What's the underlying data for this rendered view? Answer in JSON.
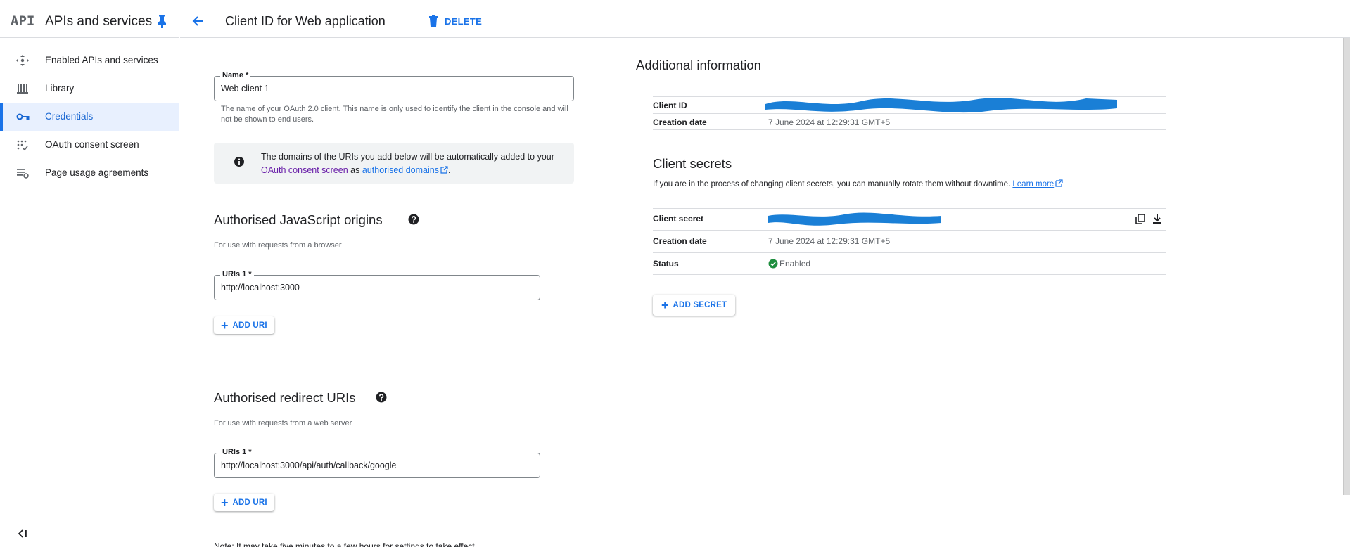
{
  "sidebar": {
    "logo": "API",
    "title": "APIs and services",
    "items": [
      {
        "label": "Enabled APIs and services",
        "icon": "enabled-apis-icon",
        "active": false
      },
      {
        "label": "Library",
        "icon": "library-icon",
        "active": false
      },
      {
        "label": "Credentials",
        "icon": "key-icon",
        "active": true
      },
      {
        "label": "OAuth consent screen",
        "icon": "consent-icon",
        "active": false
      },
      {
        "label": "Page usage agreements",
        "icon": "agreements-icon",
        "active": false
      }
    ]
  },
  "header": {
    "title": "Client ID for Web application",
    "delete_label": "DELETE"
  },
  "form": {
    "name_label": "Name *",
    "name_value": "Web client 1",
    "name_hint": "The name of your OAuth 2.0 client. This name is only used to identify the client in the console and will not be shown to end users.",
    "info_prefix": "The domains of the URIs you add below will be automatically added to your",
    "info_link1": "OAuth consent screen",
    "info_as": "as",
    "info_link2": "authorised domains",
    "info_end": ".",
    "js_origins_title": "Authorised JavaScript origins",
    "js_origins_sub": "For use with requests from a browser",
    "js_uri_label": "URIs 1 *",
    "js_uri_value": "http://localhost:3000",
    "add_uri_label": "ADD URI",
    "redirect_title": "Authorised redirect URIs",
    "redirect_sub": "For use with requests from a web server",
    "redirect_uri_label": "URIs 1 *",
    "redirect_uri_value": "http://localhost:3000/api/auth/callback/google",
    "note": "Note: It may take five minutes to a few hours for settings to take effect"
  },
  "additional": {
    "title": "Additional information",
    "client_id_key": "Client ID",
    "client_id_value": "[redacted]",
    "creation_key": "Creation date",
    "creation_value": "7 June 2024 at 12:29:31 GMT+5"
  },
  "secrets": {
    "title": "Client secrets",
    "desc": "If you are in the process of changing client secrets, you can manually rotate them without downtime.",
    "learn_more": "Learn more",
    "secret_key": "Client secret",
    "secret_value": "[redacted]",
    "creation_key": "Creation date",
    "creation_value": "7 June 2024 at 12:29:31 GMT+5",
    "status_key": "Status",
    "status_value": "Enabled",
    "add_secret_label": "ADD SECRET"
  },
  "colors": {
    "accent": "#1a73e8",
    "redaction": "#1a7fd6",
    "status_green": "#1e8e3e",
    "active_nav_bg": "#e8f0fe"
  }
}
